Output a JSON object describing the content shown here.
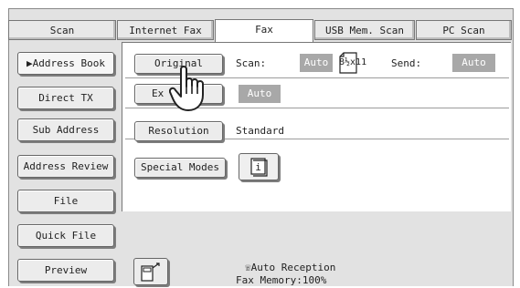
{
  "tabs": [
    {
      "label": "Scan"
    },
    {
      "label": "Internet Fax"
    },
    {
      "label": "Fax"
    },
    {
      "label": "USB Mem. Scan"
    },
    {
      "label": "PC Scan"
    }
  ],
  "sidebar": {
    "items": [
      {
        "label": "▶Address Book"
      },
      {
        "label": "Direct TX"
      },
      {
        "label": "Sub Address"
      },
      {
        "label": "Address Review"
      },
      {
        "label": "File"
      },
      {
        "label": "Quick File"
      },
      {
        "label": "Preview"
      }
    ]
  },
  "main": {
    "original_label": "Original",
    "scan_label": "Scan:",
    "scan_value": "Auto",
    "paper_size": "8½x11",
    "send_label": "Send:",
    "send_value": "Auto",
    "exposure_label": "Ex",
    "exposure_value": "Auto",
    "resolution_label": "Resolution",
    "resolution_value": "Standard",
    "special_modes_label": "Special Modes"
  },
  "status": {
    "reception": "Auto Reception",
    "memory": "Fax Memory:100%"
  },
  "colors": {
    "frame": "#e2e2e2",
    "button": "#ececec",
    "value_box": "#a8a8a8"
  }
}
